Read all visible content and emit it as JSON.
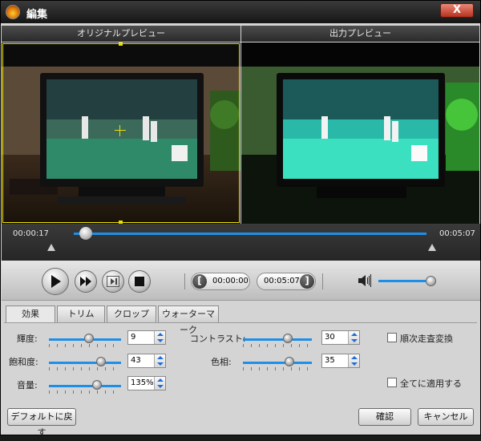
{
  "window": {
    "title": "編集",
    "close_glyph": "X"
  },
  "preview": {
    "original_label": "オリジナルプレビュー",
    "output_label": "出力プレビュー"
  },
  "timeline": {
    "current_time": "00:00:17",
    "total_time": "00:05:07",
    "position_fraction": 0.035
  },
  "playback": {
    "start_time": "00:00:00",
    "end_time": "00:05:07",
    "volume_fraction": 0.9
  },
  "tabs": [
    "効果",
    "トリム",
    "クロップ",
    "ウォーターマーク"
  ],
  "effects": {
    "brightness": {
      "label": "輝度:",
      "value": "9",
      "level": 0.55
    },
    "saturation": {
      "label": "飽和度:",
      "value": "43",
      "level": 0.72
    },
    "volume": {
      "label": "音量:",
      "value": "135%",
      "level": 0.67
    },
    "contrast": {
      "label": "コントラスト:",
      "value": "30",
      "level": 0.65
    },
    "hue": {
      "label": "色相:",
      "value": "35",
      "level": 0.67
    },
    "deinterlace_label": "順次走査変換",
    "apply_all_label": "全てに適用する"
  },
  "buttons": {
    "reset": "デフォルトに戻す",
    "ok": "確認",
    "cancel": "キャンセル"
  }
}
